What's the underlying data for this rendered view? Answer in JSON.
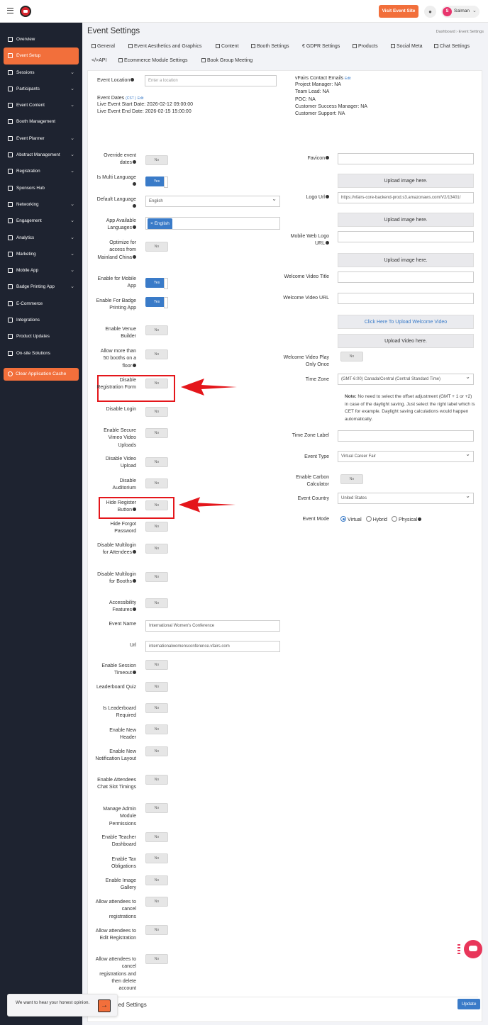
{
  "topbar": {
    "visit_label": "Visit Event Site",
    "avatar_initial": "S",
    "user_name": "Salman"
  },
  "sidebar": {
    "items": [
      {
        "label": "Overview",
        "chevron": false
      },
      {
        "label": "Event Setup",
        "chevron": false,
        "active": true
      },
      {
        "label": "Sessions",
        "chevron": true
      },
      {
        "label": "Participants",
        "chevron": true
      },
      {
        "label": "Event Content",
        "chevron": true
      },
      {
        "label": "Booth Management",
        "chevron": false
      },
      {
        "label": "Event Planner",
        "chevron": true
      },
      {
        "label": "Abstract Management",
        "chevron": true
      },
      {
        "label": "Registration",
        "chevron": true
      },
      {
        "label": "Sponsors Hub",
        "chevron": false
      },
      {
        "label": "Networking",
        "chevron": true
      },
      {
        "label": "Engagement",
        "chevron": true
      },
      {
        "label": "Analytics",
        "chevron": true
      },
      {
        "label": "Marketing",
        "chevron": true
      },
      {
        "label": "Mobile App",
        "chevron": true
      },
      {
        "label": "Badge Printing App",
        "chevron": true
      },
      {
        "label": "E-Commerce",
        "chevron": false
      },
      {
        "label": "Integrations",
        "chevron": false
      },
      {
        "label": "Product Updates",
        "chevron": false
      },
      {
        "label": "On-site Solutions",
        "chevron": false
      }
    ],
    "clear_cache_label": "Clear Application Cache"
  },
  "page": {
    "title": "Event Settings",
    "breadcrumb": "Dashboard  ›  Event Settings"
  },
  "tabs": [
    "General",
    "Event Aesthetics and Graphics",
    "Content",
    "Booth Settings",
    "GDPR Settings",
    "Products",
    "Social Meta",
    "Chat Settings",
    "API",
    "Ecommerce Module Settings",
    "Book Group Meeting"
  ],
  "general": {
    "location_label": "Event Location",
    "location_placeholder": "Enter a location",
    "dates_label": "Event Dates",
    "dates_tz": "(CST )",
    "edit_label": "Edit",
    "start_date": "Live Event Start Date: 2026-02-12 09:00:00",
    "end_date": "Live Event End Date: 2026-02-15 15:00:00",
    "contacts_title": "vFairs Contact Emails",
    "contacts": [
      "Project Manager: NA",
      "Team Lead: NA",
      "POC: NA",
      "Customer Success Manager: NA",
      "Customer Support: NA"
    ]
  },
  "left_fields": {
    "override_dates": {
      "label": "Override event dates",
      "value": "No"
    },
    "multi_language": {
      "label": "Is Multi Language",
      "value": "Yes"
    },
    "default_language": {
      "label": "Default Language",
      "value": "English"
    },
    "available_languages": {
      "label": "App Available Languages",
      "value": "× English"
    },
    "mainland_china": {
      "label": "Optimize for access from Mainland China",
      "value": "No"
    },
    "mobile_app": {
      "label": "Enable for Mobile App",
      "value": "Yes"
    },
    "badge_printing": {
      "label": "Enable For Badge Printing App",
      "value": "Yes"
    },
    "venue_builder": {
      "label": "Enable Venue Builder",
      "value": "No"
    },
    "more_booths": {
      "label": "Allow more than 50 booths on a floor",
      "value": "No"
    },
    "disable_reg_form": {
      "label": "Disable Registration Form",
      "value": "No"
    },
    "disable_login": {
      "label": "Disable Login",
      "value": "No"
    },
    "secure_vimeo": {
      "label": "Enable Secure Vimeo Video Uploads",
      "value": "No"
    },
    "disable_video_upload": {
      "label": "Disable Video Upload",
      "value": "No"
    },
    "disable_auditorium": {
      "label": "Disable Auditorium",
      "value": "No"
    },
    "hide_register": {
      "label": "Hide Register Button",
      "value": "No"
    },
    "hide_forgot": {
      "label": "Hide Forgot Password",
      "value": "No"
    },
    "multilogin_attendees": {
      "label": "Disable Multilogin for Attendees",
      "value": "No"
    },
    "multilogin_booths": {
      "label": "Disable Multilogin for Booths",
      "value": "No"
    },
    "accessibility": {
      "label": "Accessibility Features",
      "value": "No"
    },
    "event_name": {
      "label": "Event Name",
      "value": "International Women's Conference"
    },
    "url": {
      "label": "Url",
      "value": "internationalwomensconference.vfairs.com"
    },
    "session_timeout": {
      "label": "Enable Session Timeout",
      "value": "No"
    },
    "leaderboard_quiz": {
      "label": "Leaderboard Quiz",
      "value": "No"
    },
    "leaderboard_required": {
      "label": "Is Leaderboard Required",
      "value": "No"
    },
    "new_header": {
      "label": "Enable New Header",
      "value": "No"
    },
    "notification_layout": {
      "label": "Enable New Notification Layout",
      "value": "No"
    },
    "chat_slot": {
      "label": "Enable Attendees Chat Slot Timings",
      "value": "No"
    },
    "admin_permissions": {
      "label": "Manage Admin Module Permissions",
      "value": "No"
    },
    "teacher_dashboard": {
      "label": "Enable Teacher Dashboard",
      "value": "No"
    },
    "tax_obligations": {
      "label": "Enable Tax Obligations",
      "value": "No"
    },
    "image_gallery": {
      "label": "Enable Image Gallery",
      "value": "No"
    },
    "cancel_reg": {
      "label": "Allow attendees to cancel registrations",
      "value": "No"
    },
    "edit_reg": {
      "label": "Allow attendees to Edit Registration",
      "value": "No"
    },
    "cancel_delete": {
      "label": "Allow attendees to cancel registrations and then delete account",
      "value": "No"
    }
  },
  "right_fields": {
    "favicon_label": "Favicon",
    "upload_image": "Upload image here.",
    "logo_url_label": "Logo Url",
    "logo_url_value": "https://vfairs-core-backend-prod.s3.amazonaws.com/V2/13401/",
    "mobile_logo_label": "Mobile Web Logo URL",
    "welcome_title_label": "Welcome Video Title",
    "welcome_url_label": "Welcome Video URL",
    "upload_welcome_video": "Click Here To Upload Welcome Video",
    "upload_video": "Upload Video here.",
    "play_once": {
      "label": "Welcome Video Play Only Once",
      "value": "No"
    },
    "timezone_label": "Time Zone",
    "timezone_value": "(GMT-6:00) Canada/Central (Central Standard Time)",
    "note_bold": "Note:",
    "note_text": " No need to select the offset adjustment (GMT + 1 or +2) in case of the daylight saving. Just select the right label which is CET for example. Daylight saving calculations would happen automatically.",
    "tz_label_label": "Time Zone Label",
    "event_type_label": "Event Type",
    "event_type_value": "Virtual Career Fair",
    "carbon": {
      "label": "Enable Carbon Calculator",
      "value": "No"
    },
    "country_label": "Event Country",
    "country_value": "United States",
    "mode_label": "Event Mode",
    "modes": [
      "Virtual",
      "Hybrid",
      "Physical"
    ]
  },
  "footer": {
    "advanced_label": "Advanced Settings",
    "plus": "+",
    "update_label": "Update",
    "feedback_text": "We want to hear your honest opinion.",
    "feedback_go": "→"
  },
  "colors": {
    "accent": "#f26f3b",
    "primary": "#3a7bc8",
    "sidebar_bg": "#1e2330",
    "highlight": "#e4161b"
  }
}
